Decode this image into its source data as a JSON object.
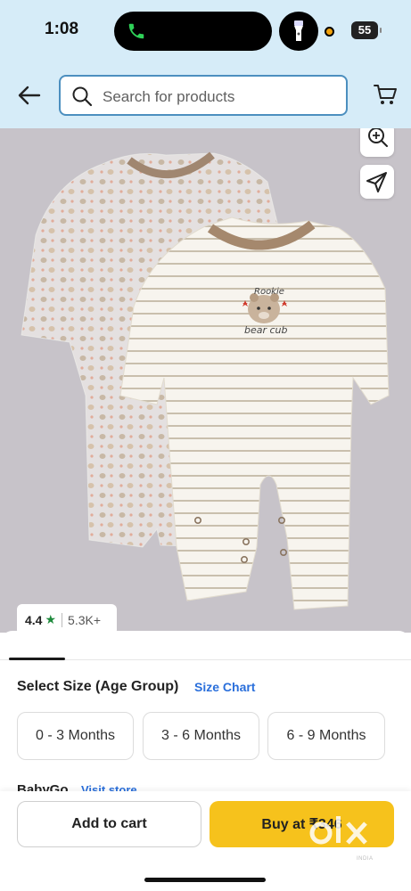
{
  "status_bar": {
    "time": "1:08",
    "battery": "55"
  },
  "header": {
    "search": {
      "placeholder": "Search for products"
    },
    "icons": [
      "back-arrow-icon",
      "search-icon",
      "cart-icon"
    ]
  },
  "product": {
    "graphic_text": [
      "Rookie",
      "bear cub"
    ],
    "rating": {
      "value": "4.4",
      "count": "5.3K+"
    }
  },
  "size_section": {
    "title": "Select Size (Age Group)",
    "chart_link": "Size Chart",
    "options": [
      "0 - 3 Months",
      "3 - 6 Months",
      "6 - 9 Months"
    ]
  },
  "seller": {
    "name": "BabyGo",
    "visit_label": "Visit store"
  },
  "actions": {
    "add_to_cart": "Add to cart",
    "buy_now": "Buy at ₹346"
  },
  "watermark": {
    "brand": "olx",
    "sub": "INDIA"
  },
  "colors": {
    "header_bg": "#d6ecf8",
    "image_bg": "#c7c3c9",
    "accent_link": "#2a6fdb",
    "buy_button": "#f6c21c",
    "rating_star": "#1e8a3c"
  }
}
